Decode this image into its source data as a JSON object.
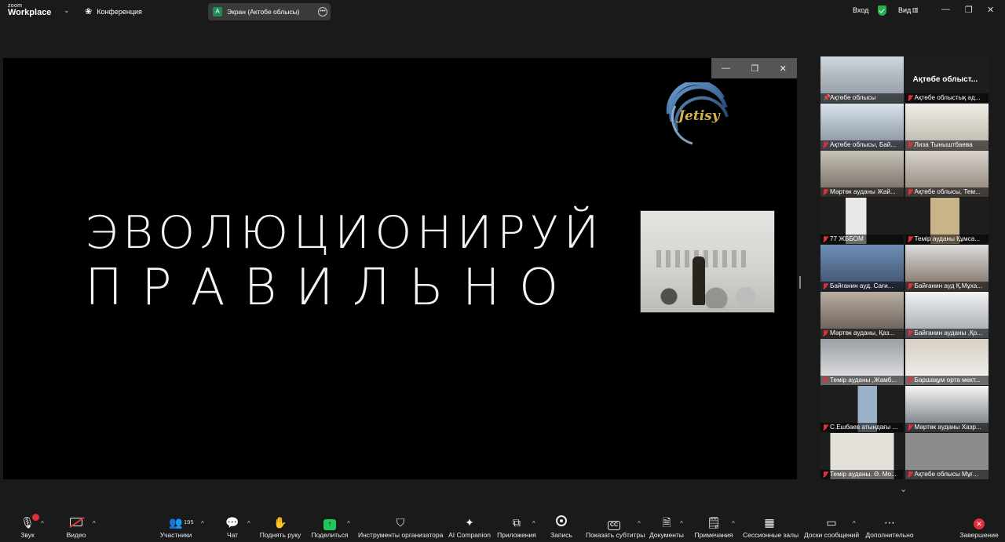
{
  "app": {
    "logo_top": "zoom",
    "logo_bottom": "Workplace",
    "meeting_label": "Конференция",
    "screen_badge": "A",
    "screen_label": "Экран (Актобе облысы)",
    "signin_label": "Вход",
    "view_label": "Вид"
  },
  "slide": {
    "line1": "ЭВОЛЮЦИОНИРУЙ",
    "line2": "ПРАВИЛЬНО",
    "logo_text": "Jetisy"
  },
  "gallery": {
    "featured_name": "Ақтөбе облыст...",
    "tiles": [
      {
        "label": "Ақтөбе облысы",
        "pinned": true
      },
      {
        "label": "Ақтөбе облыстық әд..."
      },
      {
        "label": "Ақтөбе облысы, Бай..."
      },
      {
        "label": "Лиза Тыныштбаева"
      },
      {
        "label": "Мәртөк ауданы Жай..."
      },
      {
        "label": "Ақтөбе облысы, Тем..."
      },
      {
        "label": "77 ЖББОМ"
      },
      {
        "label": "Темір ауданы Құмса..."
      },
      {
        "label": "Байғанин ауд. Сағи..."
      },
      {
        "label": "Байғанин ауд Қ.Мұха..."
      },
      {
        "label": "Мәртөк ауданы, Қаз..."
      },
      {
        "label": "Байғанин ауданы ,Қо..."
      },
      {
        "label": "Темір ауданы ,Жамб..."
      },
      {
        "label": "Баршақұм орта мект..."
      },
      {
        "label": "С.Ешбаев атындағы ..."
      },
      {
        "label": "Мәртөк ауданы Хазр..."
      },
      {
        "label": "Темір ауданы. Ә. Мо..."
      },
      {
        "label": "Ақтөбе облысы Мұғ..."
      }
    ]
  },
  "toolbar": {
    "audio": "Звук",
    "video": "Видео",
    "participants": "Участники",
    "participants_count": "195",
    "chat": "Чат",
    "raise_hand": "Поднять руку",
    "share": "Поделиться",
    "host_tools": "Инструменты организатора",
    "ai_companion": "AI Companion",
    "apps": "Приложения",
    "record": "Запись",
    "captions": "Показать субтитры",
    "docs": "Документы",
    "notes": "Примечания",
    "breakout": "Сессионные залы",
    "whiteboards": "Доски сообщений",
    "more": "Дополнительно",
    "end": "Завершение"
  },
  "colors": {
    "accent_green": "#22c55e",
    "muted_red": "#e02f3b",
    "shield_green": "#22b14c",
    "active_speaker": "#2ecc71"
  }
}
